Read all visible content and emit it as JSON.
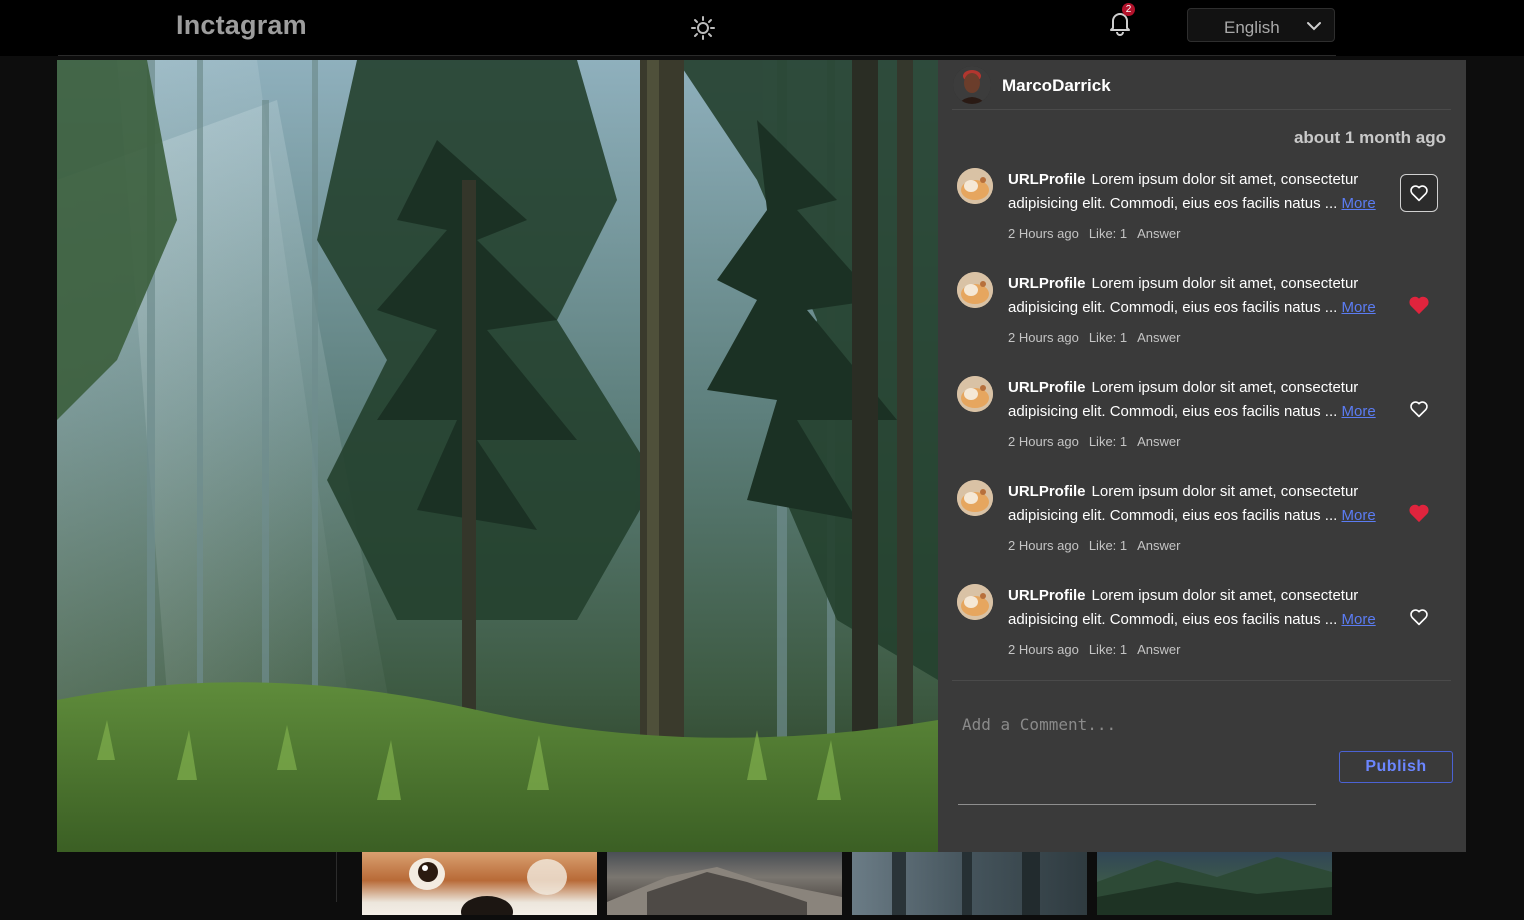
{
  "app": {
    "logo": "Inctagram"
  },
  "header": {
    "notifications_count": "2",
    "language": {
      "selected": "English"
    },
    "icons": {
      "theme": "sun-icon",
      "notifications": "bell-icon",
      "language_toggle": "chevron-down-icon"
    }
  },
  "post": {
    "author": {
      "name": "MarcoDarrick"
    },
    "posted_ago": "about 1 month ago",
    "comments": [
      {
        "user": "URLProfile",
        "text": "Lorem ipsum dolor sit amet, consectetur adipisicing elit. Commodi, eius eos facilis natus ...",
        "more": "More",
        "time": "2 Hours ago",
        "likes": "Like: 1",
        "answer": "Answer",
        "liked": false
      },
      {
        "user": "URLProfile",
        "text": "Lorem ipsum dolor sit amet, consectetur adipisicing elit. Commodi, eius eos facilis natus ...",
        "more": "More",
        "time": "2 Hours ago",
        "likes": "Like: 1",
        "answer": "Answer",
        "liked": true
      },
      {
        "user": "URLProfile",
        "text": "Lorem ipsum dolor sit amet, consectetur adipisicing elit. Commodi, eius eos facilis natus ...",
        "more": "More",
        "time": "2 Hours ago",
        "likes": "Like: 1",
        "answer": "Answer",
        "liked": false
      },
      {
        "user": "URLProfile",
        "text": "Lorem ipsum dolor sit amet, consectetur adipisicing elit. Commodi, eius eos facilis natus ...",
        "more": "More",
        "time": "2 Hours ago",
        "likes": "Like: 1",
        "answer": "Answer",
        "liked": true
      },
      {
        "user": "URLProfile",
        "text": "Lorem ipsum dolor sit amet, consectetur adipisicing elit. Commodi, eius eos facilis natus ...",
        "more": "More",
        "time": "2 Hours ago",
        "likes": "Like: 1",
        "answer": "Answer",
        "liked": false
      }
    ],
    "add_comment": {
      "placeholder": "Add a Comment...",
      "value": ""
    },
    "publish_label": "Publish"
  },
  "colors": {
    "accent": "#4b62d4",
    "link": "#5b7cf3",
    "liked_heart": "#e0243d",
    "panel_bg": "#3a3a3a",
    "badge": "#b3122b"
  }
}
